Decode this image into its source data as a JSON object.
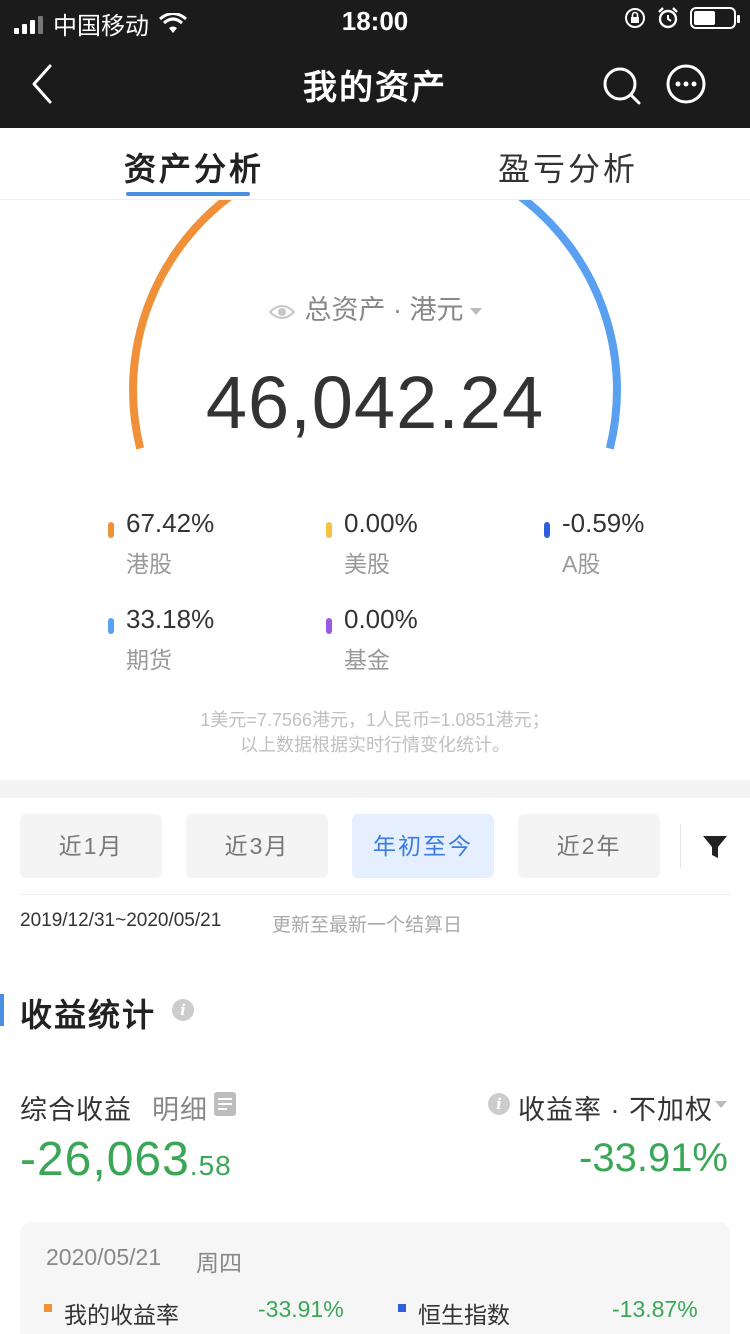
{
  "status_bar": {
    "carrier": "中国移动",
    "time": "18:00"
  },
  "nav": {
    "title": "我的资产",
    "icons": [
      "back-icon",
      "search-icon",
      "more-icon"
    ]
  },
  "tabs": [
    {
      "label": "资产分析",
      "active": true
    },
    {
      "label": "盈亏分析",
      "active": false
    }
  ],
  "summary": {
    "label": "总资产 · 港元",
    "value": "46,042.24",
    "note_line1": "1美元=7.7566港元，1人民币=1.0851港元；",
    "note_line2": "以上数据根据实时行情变化统计。",
    "gauge_hk_share": 0.6742
  },
  "allocation": [
    {
      "pct": "67.42%",
      "label": "港股",
      "color": "#f0913a"
    },
    {
      "pct": "0.00%",
      "label": "美股",
      "color": "#f5c342"
    },
    {
      "pct": "-0.59%",
      "label": "A股",
      "color": "#2f5fd9"
    },
    {
      "pct": "33.18%",
      "label": "期货",
      "color": "#5aa0f0"
    },
    {
      "pct": "0.00%",
      "label": "基金",
      "color": "#9b59e8"
    }
  ],
  "period": {
    "options": [
      {
        "label": "近1月",
        "active": false
      },
      {
        "label": "近3月",
        "active": false
      },
      {
        "label": "年初至今",
        "active": true
      },
      {
        "label": "近2年",
        "active": false
      }
    ],
    "date_range": "2019/12/31~2020/05/21",
    "update_note": "更新至最新一个结算日"
  },
  "stats": {
    "title": "收益统计",
    "combo_label": "综合收益",
    "detail_label": "明细",
    "rate_label": "收益率 · 不加权",
    "pnl_int": "-26,063",
    "pnl_dec": ".58",
    "rate_value": "-33.91%",
    "card": {
      "date": "2020/05/21",
      "weekday": "周四",
      "my_label": "我的收益率",
      "my_value": "-33.91%",
      "index_label": "恒生指数",
      "index_value": "-13.87%"
    }
  },
  "colors": {
    "accent": "#4a90e2",
    "gain_loss_green": "#3aa757",
    "header_bg": "#1b1b1b"
  }
}
